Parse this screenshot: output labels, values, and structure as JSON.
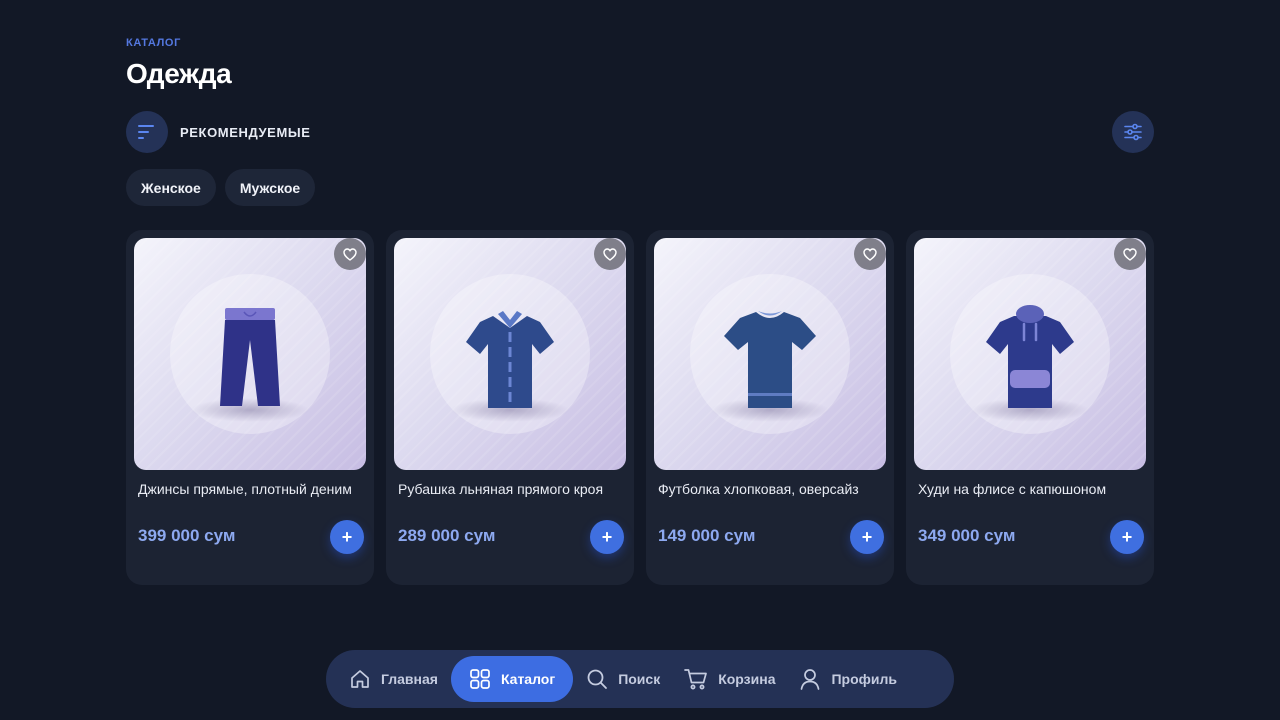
{
  "header": {
    "eyebrow": "КАТАЛОГ",
    "title": "Одежда"
  },
  "sort": {
    "icon": "sort-icon",
    "label": "РЕКОМЕНДУЕМЫЕ"
  },
  "filter": {
    "icon": "sliders-icon"
  },
  "chips": [
    {
      "label": "Женское"
    },
    {
      "label": "Мужское"
    }
  ],
  "products": [
    {
      "name": "Джинсы прямые, плотный деним",
      "price": "399 000 сум",
      "image": "jeans"
    },
    {
      "name": "Рубашка льняная прямого кроя",
      "price": "289 000 сум",
      "image": "shirt"
    },
    {
      "name": "Футболка хлопковая, оверсайз",
      "price": "149 000 сум",
      "image": "t-shirt"
    },
    {
      "name": "Худи на флисе с капюшоном",
      "price": "349 000 сум",
      "image": "hoodie"
    }
  ],
  "product_actions": {
    "favorite_icon": "heart-icon",
    "add_label": "+"
  },
  "nav": {
    "items": [
      {
        "label": "Главная",
        "icon": "home-icon",
        "active": false
      },
      {
        "label": "Каталог",
        "icon": "grid-icon",
        "active": true
      },
      {
        "label": "Поиск",
        "icon": "search-icon",
        "active": false
      },
      {
        "label": "Корзина",
        "icon": "cart-icon",
        "active": false
      },
      {
        "label": "Профиль",
        "icon": "user-icon",
        "active": false
      }
    ]
  },
  "colors": {
    "background": "#121826",
    "card": "#1c2333",
    "accent": "#3d6de2",
    "price": "#8da9f0",
    "eyebrow": "#5478e0"
  }
}
